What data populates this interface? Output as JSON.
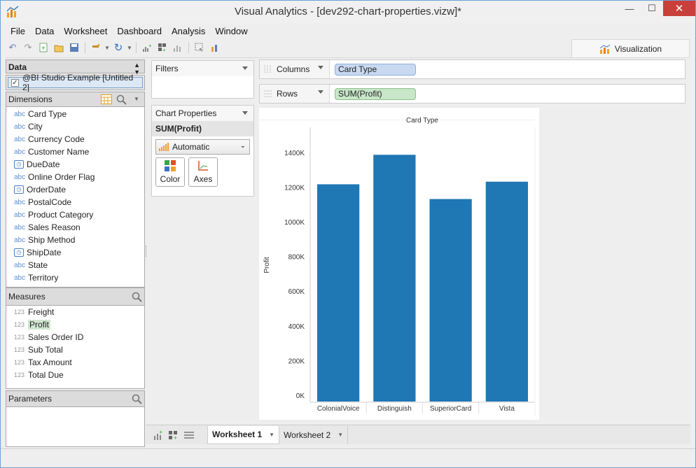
{
  "window": {
    "title": "Visual Analytics - [dev292-chart-properties.vizw]*",
    "minimize": "—",
    "maximize": "☐",
    "close": "✕"
  },
  "menu": [
    "File",
    "Data",
    "Worksheet",
    "Dashboard",
    "Analysis",
    "Window"
  ],
  "visualization_tab": "Visualization",
  "data_panel": {
    "header": "Data",
    "source": "@BI Studio Example [Untitled 2]",
    "dimensions_label": "Dimensions",
    "dimensions": [
      {
        "type": "abc",
        "name": "Card Type"
      },
      {
        "type": "abc",
        "name": "City"
      },
      {
        "type": "abc",
        "name": "Currency Code"
      },
      {
        "type": "abc",
        "name": "Customer Name"
      },
      {
        "type": "date",
        "name": "DueDate"
      },
      {
        "type": "abc",
        "name": "Online Order Flag"
      },
      {
        "type": "date",
        "name": "OrderDate"
      },
      {
        "type": "abc",
        "name": "PostalCode"
      },
      {
        "type": "abc",
        "name": "Product Category"
      },
      {
        "type": "abc",
        "name": "Sales Reason"
      },
      {
        "type": "abc",
        "name": "Ship Method"
      },
      {
        "type": "date",
        "name": "ShipDate"
      },
      {
        "type": "abc",
        "name": "State"
      },
      {
        "type": "abc",
        "name": "Territory"
      }
    ],
    "measures_label": "Measures",
    "measures": [
      {
        "type": "123",
        "name": "Freight"
      },
      {
        "type": "123",
        "name": "Profit"
      },
      {
        "type": "123",
        "name": "Sales Order ID"
      },
      {
        "type": "123",
        "name": "Sub Total"
      },
      {
        "type": "123",
        "name": "Tax Amount"
      },
      {
        "type": "123",
        "name": "Total Due"
      }
    ],
    "parameters_label": "Parameters"
  },
  "filters": {
    "label": "Filters"
  },
  "chart_properties": {
    "label": "Chart Properties",
    "measure": "SUM(Profit)",
    "mark_type": "Automatic",
    "color_label": "Color",
    "axes_label": "Axes"
  },
  "shelves": {
    "columns_label": "Columns",
    "columns_pill": "Card Type",
    "rows_label": "Rows",
    "rows_pill": "SUM(Profit)"
  },
  "chart_data": {
    "type": "bar",
    "title": "Card Type",
    "ylabel": "Profit",
    "xlabel": "",
    "categories": [
      "ColonialVoice",
      "Distinguish",
      "SuperiorCard",
      "Vista"
    ],
    "values": [
      1220000,
      1390000,
      1135000,
      1235000
    ],
    "ylim": [
      0,
      1500000
    ],
    "yticks": [
      "0K",
      "200K",
      "400K",
      "600K",
      "800K",
      "1000K",
      "1200K",
      "1400K"
    ],
    "color": "#1f77b4"
  },
  "worksheets": [
    "Worksheet 1",
    "Worksheet 2"
  ]
}
